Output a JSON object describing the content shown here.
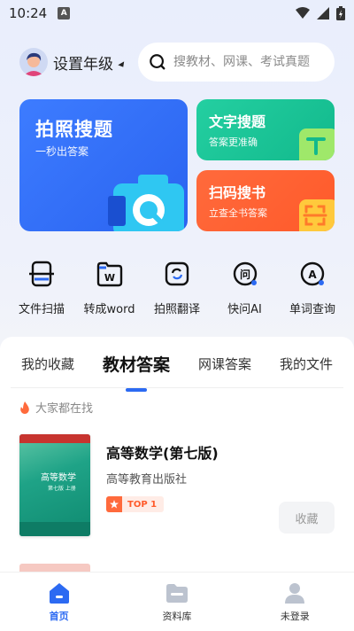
{
  "status_bar": {
    "time": "10:24",
    "notif_icon": "A"
  },
  "header": {
    "grade_label": "设置年级",
    "search_placeholder": "搜教材、网课、考试真题"
  },
  "feature_cards": {
    "photo_search": {
      "title": "拍照搜题",
      "subtitle": "一秒出答案"
    },
    "text_search": {
      "title": "文字搜题",
      "subtitle": "答案更准确"
    },
    "scan_book": {
      "title": "扫码搜书",
      "subtitle": "立查全书答案"
    }
  },
  "tools": [
    {
      "label": "文件扫描",
      "icon": "scanner-icon"
    },
    {
      "label": "转成word",
      "icon": "word-doc-icon"
    },
    {
      "label": "拍照翻译",
      "icon": "camera-translate-icon"
    },
    {
      "label": "快问AI",
      "icon": "ai-chat-icon"
    },
    {
      "label": "单词查询",
      "icon": "word-lookup-icon"
    }
  ],
  "tabs": [
    "我的收藏",
    "教材答案",
    "网课答案",
    "我的文件"
  ],
  "active_tab": "教材答案",
  "hot_label": "大家都在找",
  "book": {
    "title": "高等数学(第七版)",
    "publisher": "高等教育出版社",
    "rank": "TOP 1",
    "cover_title": "高等数学",
    "cover_subtitle": "第七版 上册",
    "fav_label": "收藏"
  },
  "bottom_nav": [
    {
      "label": "首页",
      "active": true
    },
    {
      "label": "资料库",
      "active": false
    },
    {
      "label": "未登录",
      "active": false
    }
  ],
  "colors": {
    "accent": "#2c6af2",
    "green": "#12b98c",
    "orange": "#ff5a2a"
  }
}
